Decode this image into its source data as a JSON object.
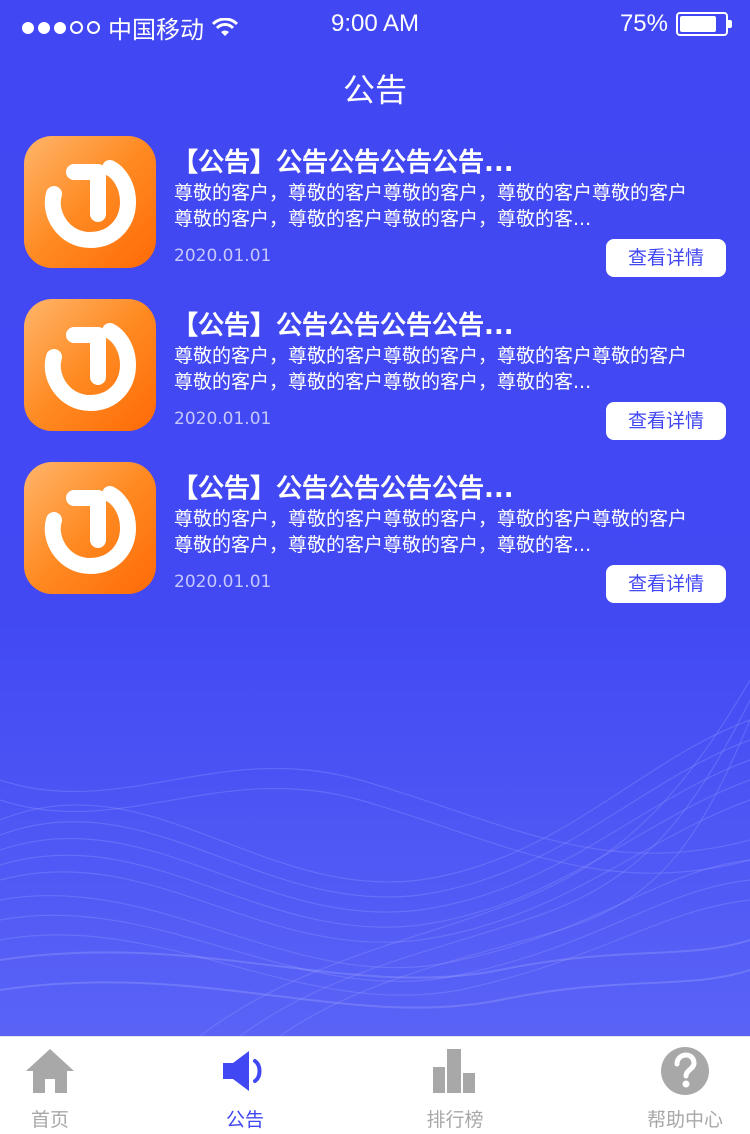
{
  "status_bar": {
    "carrier": "中国移动",
    "time": "9:00 AM",
    "battery": "75%"
  },
  "header": {
    "title": "公告"
  },
  "notices": [
    {
      "title": "【公告】公告公告公告公告...",
      "desc": "尊敬的客户，尊敬的客户尊敬的客户，尊敬的客户尊敬的客户\n尊敬的客户，尊敬的客户尊敬的客户，尊敬的客...",
      "date": "2020.01.01",
      "button": "查看详情"
    },
    {
      "title": "【公告】公告公告公告公告...",
      "desc": "尊敬的客户，尊敬的客户尊敬的客户，尊敬的客户尊敬的客户\n尊敬的客户，尊敬的客户尊敬的客户，尊敬的客...",
      "date": "2020.01.01",
      "button": "查看详情"
    },
    {
      "title": "【公告】公告公告公告公告...",
      "desc": "尊敬的客户，尊敬的客户尊敬的客户，尊敬的客户尊敬的客户\n尊敬的客户，尊敬的客户尊敬的客户，尊敬的客...",
      "date": "2020.01.01",
      "button": "查看详情"
    }
  ],
  "tabbar": {
    "items": [
      {
        "label": "首页",
        "icon": "home-icon",
        "active": false
      },
      {
        "label": "公告",
        "icon": "speaker-icon",
        "active": true
      },
      {
        "label": "排行榜",
        "icon": "podium-icon",
        "active": false
      },
      {
        "label": "帮助中心",
        "icon": "help-icon",
        "active": false
      }
    ]
  },
  "colors": {
    "background": "#4147F2",
    "accent": "#4147F2",
    "logo_orange": "#FF8A22",
    "inactive_tab": "#A8A8A8",
    "date_text": "#C6C8FF"
  }
}
